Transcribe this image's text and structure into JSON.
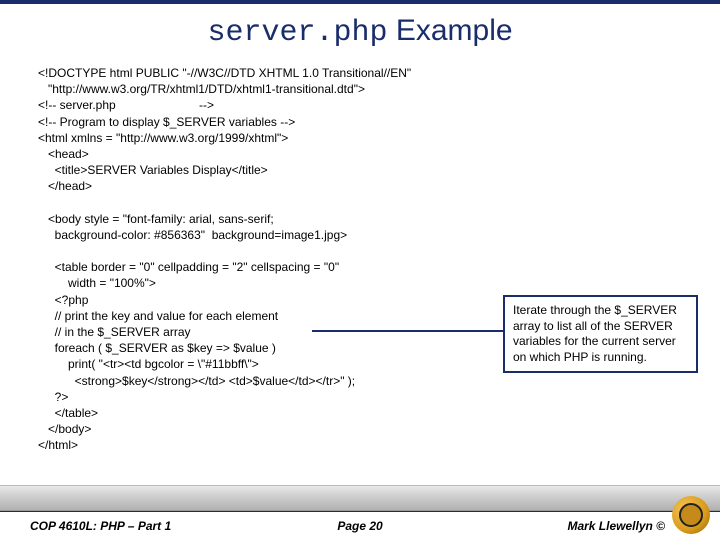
{
  "title": {
    "mono": "server.php",
    "rest": " Example"
  },
  "code": {
    "l1": "<!DOCTYPE html PUBLIC \"-//W3C//DTD XHTML 1.0 Transitional//EN\"",
    "l2": "   \"http://www.w3.org/TR/xhtml1/DTD/xhtml1-transitional.dtd\">",
    "l3": "<!-- server.php                         -->",
    "l4": "<!-- Program to display $_SERVER variables -->",
    "l5": "<html xmlns = \"http://www.w3.org/1999/xhtml\">",
    "l6": "   <head>",
    "l7": "     <title>SERVER Variables Display</title>",
    "l8": "   </head>",
    "l9": "",
    "l10": "   <body style = \"font-family: arial, sans-serif;",
    "l11": "     background-color: #856363\"  background=image1.jpg>",
    "l12": "",
    "l13": "     <table border = \"0\" cellpadding = \"2\" cellspacing = \"0\"",
    "l14": "         width = \"100%\">",
    "l15": "     <?php",
    "l16": "     // print the key and value for each element",
    "l17": "     // in the $_SERVER array",
    "l18": "     foreach ( $_SERVER as $key => $value )",
    "l19": "         print( \"<tr><td bgcolor = \\\"#11bbff\\\">",
    "l20": "           <strong>$key</strong></td> <td>$value</td></tr>\" );",
    "l21": "     ?>",
    "l22": "     </table>",
    "l23": "   </body>",
    "l24": "</html>"
  },
  "callout": "Iterate through the $_SERVER array to list all of the SERVER variables for the current server on which PHP is running.",
  "footer": {
    "left": "COP 4610L:  PHP – Part 1",
    "center": "Page 20",
    "right": "Mark Llewellyn ©"
  }
}
